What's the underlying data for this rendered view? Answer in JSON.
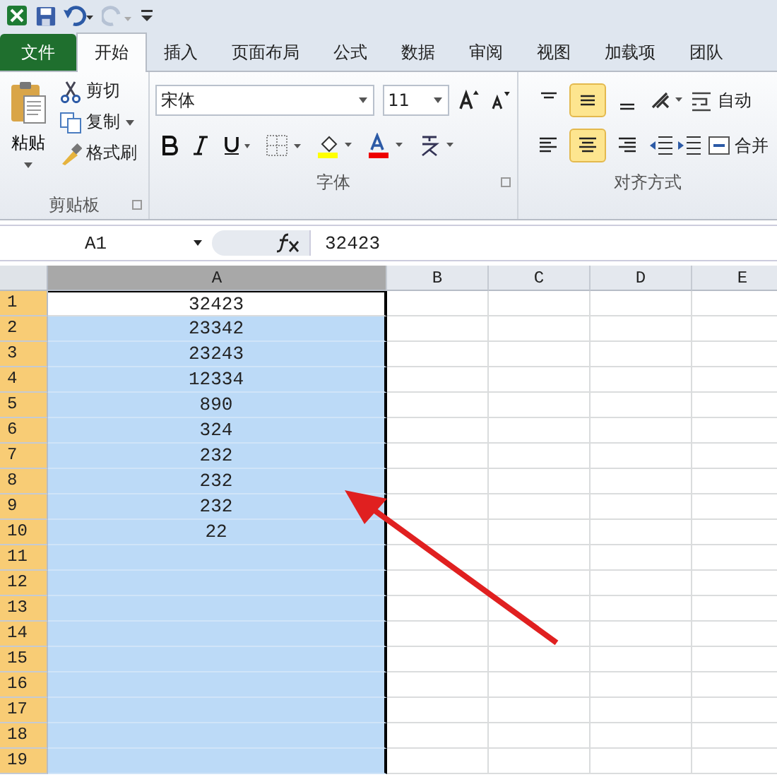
{
  "tabs": [
    {
      "label": "文件",
      "kind": "file",
      "selected": false
    },
    {
      "label": "开始",
      "kind": "tab",
      "selected": true
    },
    {
      "label": "插入",
      "kind": "tab",
      "selected": false
    },
    {
      "label": "页面布局",
      "kind": "tab",
      "selected": false
    },
    {
      "label": "公式",
      "kind": "tab",
      "selected": false
    },
    {
      "label": "数据",
      "kind": "tab",
      "selected": false
    },
    {
      "label": "审阅",
      "kind": "tab",
      "selected": false
    },
    {
      "label": "视图",
      "kind": "tab",
      "selected": false
    },
    {
      "label": "加载项",
      "kind": "tab",
      "selected": false
    },
    {
      "label": "团队",
      "kind": "tab",
      "selected": false
    }
  ],
  "clipboard": {
    "paste": "粘贴",
    "cut": "剪切",
    "copy": "复制",
    "painter": "格式刷",
    "label": "剪贴板"
  },
  "font": {
    "name": "宋体",
    "size": "11",
    "label": "字体"
  },
  "alignment": {
    "label": "对齐方式",
    "wrap": "自动",
    "merge": "合并",
    "vertical": [
      {
        "kind": "top",
        "selected": false
      },
      {
        "kind": "middle",
        "selected": true
      },
      {
        "kind": "bottom",
        "selected": false
      }
    ],
    "horizontal": [
      {
        "kind": "left",
        "selected": false
      },
      {
        "kind": "center",
        "selected": true
      },
      {
        "kind": "right",
        "selected": false
      }
    ]
  },
  "name_box": "A1",
  "formula": "32423",
  "columns": [
    {
      "label": "A",
      "selected": true
    },
    {
      "label": "B",
      "selected": false
    },
    {
      "label": "C",
      "selected": false
    },
    {
      "label": "D",
      "selected": false
    },
    {
      "label": "E",
      "selected": false
    }
  ],
  "rows": [
    {
      "label": "1",
      "selected": true,
      "active": true,
      "value": "32423"
    },
    {
      "label": "2",
      "selected": true,
      "active": false,
      "value": "23342"
    },
    {
      "label": "3",
      "selected": true,
      "active": false,
      "value": "23243"
    },
    {
      "label": "4",
      "selected": true,
      "active": false,
      "value": "12334"
    },
    {
      "label": "5",
      "selected": true,
      "active": false,
      "value": "890"
    },
    {
      "label": "6",
      "selected": true,
      "active": false,
      "value": "324"
    },
    {
      "label": "7",
      "selected": true,
      "active": false,
      "value": "232"
    },
    {
      "label": "8",
      "selected": true,
      "active": false,
      "value": "232"
    },
    {
      "label": "9",
      "selected": true,
      "active": false,
      "value": "232"
    },
    {
      "label": "10",
      "selected": true,
      "active": false,
      "value": "22"
    },
    {
      "label": "11",
      "selected": true,
      "active": false
    },
    {
      "label": "12",
      "selected": true,
      "active": false
    },
    {
      "label": "13",
      "selected": true,
      "active": false
    },
    {
      "label": "14",
      "selected": true,
      "active": false
    },
    {
      "label": "15",
      "selected": true,
      "active": false
    },
    {
      "label": "16",
      "selected": true,
      "active": false
    },
    {
      "label": "17",
      "selected": true,
      "active": false
    },
    {
      "label": "18",
      "selected": true,
      "active": false
    },
    {
      "label": "19",
      "selected": true,
      "active": false
    }
  ]
}
